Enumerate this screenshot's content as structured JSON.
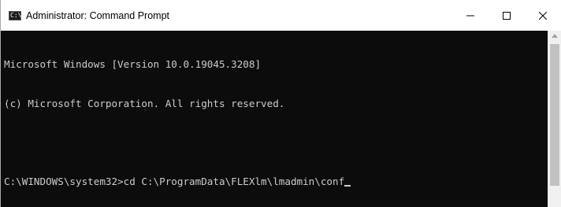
{
  "window": {
    "title": "Administrator: Command Prompt",
    "icon_glyph": "C:\\"
  },
  "controls": {
    "minimize_icon": "minimize-icon",
    "maximize_icon": "maximize-icon",
    "close_icon": "close-icon"
  },
  "console": {
    "lines": [
      "Microsoft Windows [Version 10.0.19045.3208]",
      "(c) Microsoft Corporation. All rights reserved.",
      "",
      "C:\\WINDOWS\\system32>cd C:\\ProgramData\\FLEXlm\\lmadmin\\conf"
    ]
  },
  "colors": {
    "console_bg": "#0c0c0c",
    "console_text": "#cccccc"
  }
}
